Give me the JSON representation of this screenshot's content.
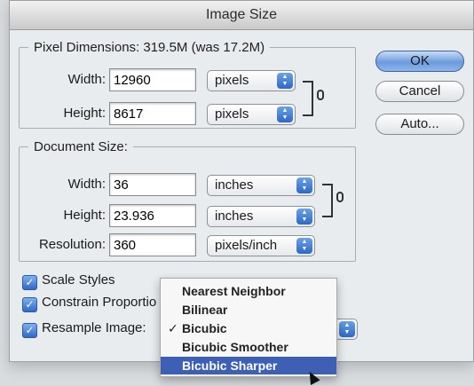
{
  "dialog": {
    "title": "Image Size"
  },
  "pixel_dimensions": {
    "legend": "Pixel Dimensions:  319.5M (was 17.2M)",
    "width_label": "Width:",
    "width_value": "12960",
    "width_unit": "pixels",
    "height_label": "Height:",
    "height_value": "8617",
    "height_unit": "pixels"
  },
  "document_size": {
    "legend": "Document Size:",
    "width_label": "Width:",
    "width_value": "36",
    "width_unit": "inches",
    "height_label": "Height:",
    "height_value": "23.936",
    "height_unit": "inches",
    "resolution_label": "Resolution:",
    "resolution_value": "360",
    "resolution_unit": "pixels/inch"
  },
  "buttons": {
    "ok": "OK",
    "cancel": "Cancel",
    "auto": "Auto..."
  },
  "options": {
    "scale_styles": "Scale Styles",
    "constrain_proportions": "Constrain Proportio",
    "resample_image": "Resample Image:"
  },
  "resample_menu": {
    "items": [
      {
        "label": "Nearest Neighbor",
        "checked": false,
        "highlighted": false
      },
      {
        "label": "Bilinear",
        "checked": false,
        "highlighted": false
      },
      {
        "label": "Bicubic",
        "checked": true,
        "highlighted": false
      },
      {
        "label": "Bicubic Smoother",
        "checked": false,
        "highlighted": false
      },
      {
        "label": "Bicubic Sharper",
        "checked": false,
        "highlighted": true
      }
    ],
    "check_glyph": "✓"
  },
  "colors": {
    "accent": "#3d5fb4",
    "window_bg": "#e9ecee"
  }
}
